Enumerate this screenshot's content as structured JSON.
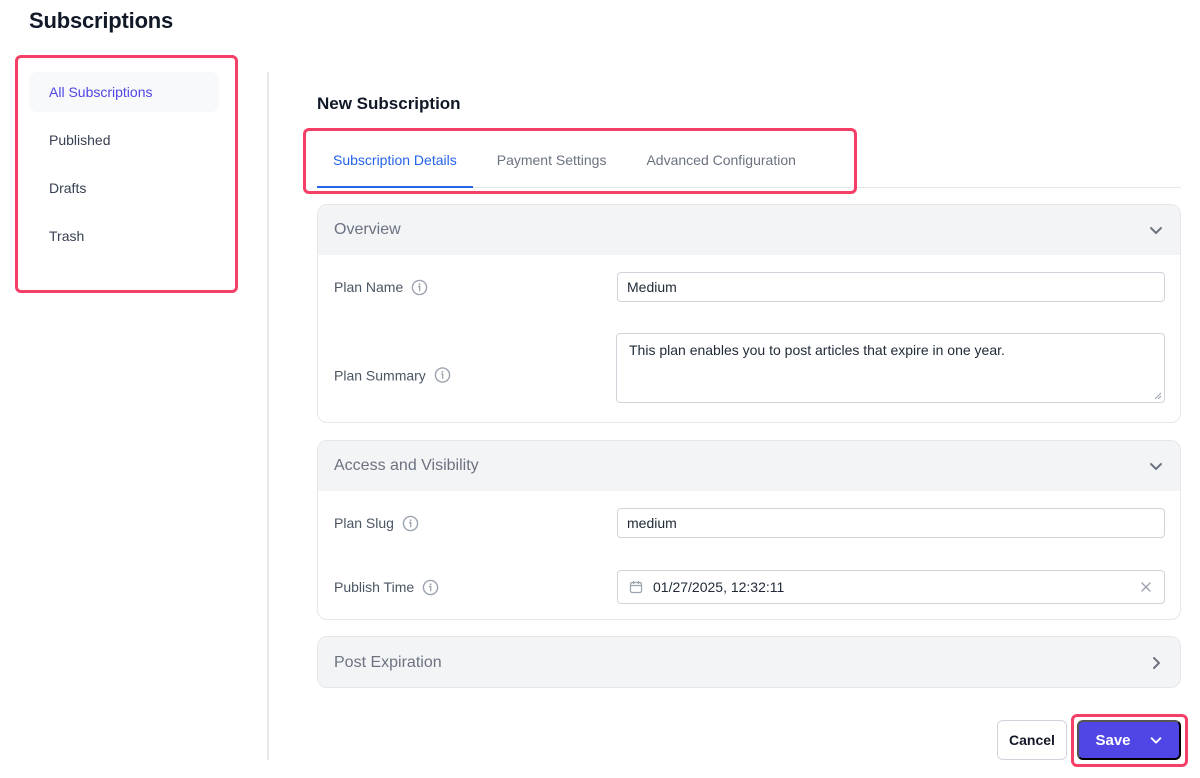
{
  "page": {
    "title": "Subscriptions"
  },
  "sidebar": {
    "items": [
      {
        "label": "All Subscriptions",
        "active": true
      },
      {
        "label": "Published",
        "active": false
      },
      {
        "label": "Drafts",
        "active": false
      },
      {
        "label": "Trash",
        "active": false
      }
    ]
  },
  "main": {
    "title": "New Subscription",
    "tabs": [
      {
        "label": "Subscription Details",
        "active": true
      },
      {
        "label": "Payment Settings",
        "active": false
      },
      {
        "label": "Advanced Configuration",
        "active": false
      }
    ],
    "panels": {
      "overview": {
        "title": "Overview",
        "expanded": true,
        "icon": "chevron-down-icon",
        "fields": {
          "plan_name": {
            "label": "Plan Name",
            "value": "Medium",
            "icon": "info-icon"
          },
          "plan_summary": {
            "label": "Plan Summary",
            "value": "This plan enables you to post articles that expire in one year.",
            "icon": "info-icon"
          }
        }
      },
      "access": {
        "title": "Access and Visibility",
        "expanded": true,
        "icon": "chevron-down-icon",
        "fields": {
          "plan_slug": {
            "label": "Plan Slug",
            "value": "medium",
            "icon": "info-icon"
          },
          "publish_time": {
            "label": "Publish Time",
            "value": "01/27/2025, 12:32:11",
            "icon": "info-icon",
            "prefix_icon": "calendar-icon",
            "suffix_icon": "clear-icon"
          }
        }
      },
      "expiration": {
        "title": "Post Expiration",
        "expanded": false,
        "icon": "chevron-right-icon"
      }
    }
  },
  "actions": {
    "cancel_label": "Cancel",
    "save_label": "Save",
    "save_icon": "chevron-down-icon"
  },
  "colors": {
    "accent": "#4f46e5",
    "tab_active": "#2563eb",
    "highlight": "#f43f67"
  }
}
